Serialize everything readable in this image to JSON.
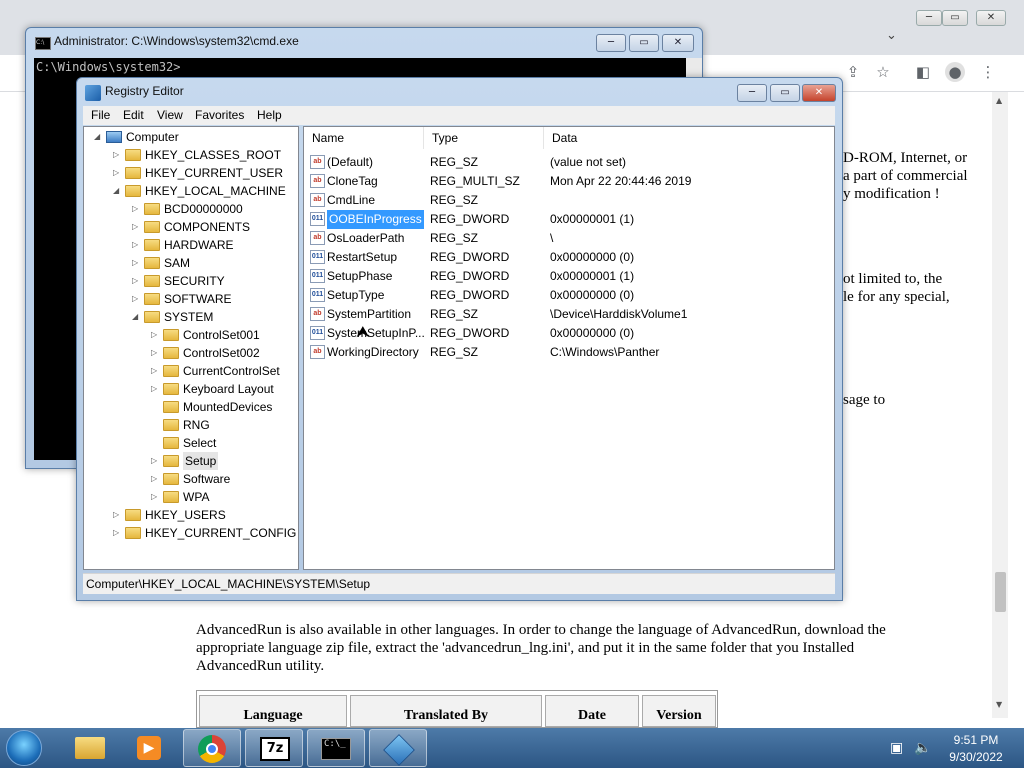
{
  "browser": {
    "page_lines": [
      "D-ROM, Internet, or",
      "a part of commercial",
      "y modification !",
      "ot limited to, the",
      "le for any special,",
      "sage to"
    ],
    "advancedrun_paragraph": [
      "AdvancedRun is also available in other languages. In order to change the language of AdvancedRun, download the",
      "appropriate language zip file, extract the 'advancedrun_lng.ini', and put it in the same folder that you Installed",
      "AdvancedRun utility."
    ],
    "table_headers": [
      "Language",
      "Translated By",
      "Date",
      "Version"
    ]
  },
  "cmd": {
    "title": "Administrator: C:\\Windows\\system32\\cmd.exe",
    "prompt": "C:\\Windows\\system32>"
  },
  "regedit": {
    "title": "Registry Editor",
    "menu": [
      "File",
      "Edit",
      "View",
      "Favorites",
      "Help"
    ],
    "columns": [
      "Name",
      "Type",
      "Data"
    ],
    "status": "Computer\\HKEY_LOCAL_MACHINE\\SYSTEM\\Setup",
    "tree": [
      {
        "label": "Computer",
        "level": 0,
        "expanded": true
      },
      {
        "label": "HKEY_CLASSES_ROOT",
        "level": 1
      },
      {
        "label": "HKEY_CURRENT_USER",
        "level": 1
      },
      {
        "label": "HKEY_LOCAL_MACHINE",
        "level": 1,
        "expanded": true
      },
      {
        "label": "BCD00000000",
        "level": 2
      },
      {
        "label": "COMPONENTS",
        "level": 2
      },
      {
        "label": "HARDWARE",
        "level": 2
      },
      {
        "label": "SAM",
        "level": 2
      },
      {
        "label": "SECURITY",
        "level": 2
      },
      {
        "label": "SOFTWARE",
        "level": 2
      },
      {
        "label": "SYSTEM",
        "level": 2,
        "expanded": true
      },
      {
        "label": "ControlSet001",
        "level": 3
      },
      {
        "label": "ControlSet002",
        "level": 3
      },
      {
        "label": "CurrentControlSet",
        "level": 3
      },
      {
        "label": "Keyboard Layout",
        "level": 3
      },
      {
        "label": "MountedDevices",
        "level": 3,
        "noarrow": true
      },
      {
        "label": "RNG",
        "level": 3,
        "noarrow": true
      },
      {
        "label": "Select",
        "level": 3,
        "noarrow": true
      },
      {
        "label": "Setup",
        "level": 3,
        "selected": true
      },
      {
        "label": "Software",
        "level": 3
      },
      {
        "label": "WPA",
        "level": 3
      },
      {
        "label": "HKEY_USERS",
        "level": 1
      },
      {
        "label": "HKEY_CURRENT_CONFIG",
        "level": 1
      }
    ],
    "values": [
      {
        "name": "(Default)",
        "type": "REG_SZ",
        "data": "(value not set)",
        "icon": "string-value-icon"
      },
      {
        "name": "CloneTag",
        "type": "REG_MULTI_SZ",
        "data": "Mon Apr 22 20:44:46 2019",
        "icon": "string-value-icon"
      },
      {
        "name": "CmdLine",
        "type": "REG_SZ",
        "data": "",
        "icon": "string-value-icon"
      },
      {
        "name": "OOBEInProgress",
        "type": "REG_DWORD",
        "data": "0x00000001 (1)",
        "icon": "binary-value-icon",
        "selected": true
      },
      {
        "name": "OsLoaderPath",
        "type": "REG_SZ",
        "data": "\\",
        "icon": "string-value-icon"
      },
      {
        "name": "RestartSetup",
        "type": "REG_DWORD",
        "data": "0x00000000 (0)",
        "icon": "binary-value-icon"
      },
      {
        "name": "SetupPhase",
        "type": "REG_DWORD",
        "data": "0x00000001 (1)",
        "icon": "binary-value-icon"
      },
      {
        "name": "SetupType",
        "type": "REG_DWORD",
        "data": "0x00000000 (0)",
        "icon": "binary-value-icon"
      },
      {
        "name": "SystemPartition",
        "type": "REG_SZ",
        "data": "\\Device\\HarddiskVolume1",
        "icon": "string-value-icon"
      },
      {
        "name": "SystemSetupInP...",
        "type": "REG_DWORD",
        "data": "0x00000000 (0)",
        "icon": "binary-value-icon"
      },
      {
        "name": "WorkingDirectory",
        "type": "REG_SZ",
        "data": "C:\\Windows\\Panther",
        "icon": "string-value-icon"
      }
    ]
  },
  "taskbar": {
    "apps": [
      "windows-explorer-icon",
      "media-player-icon",
      "chrome-icon",
      "7zip-icon",
      "cmd-icon",
      "regedit-icon"
    ],
    "icon_labels": {
      "sevenzip": "7z",
      "cmd": "C:\\_"
    },
    "time": "9:51 PM",
    "date": "9/30/2022"
  }
}
